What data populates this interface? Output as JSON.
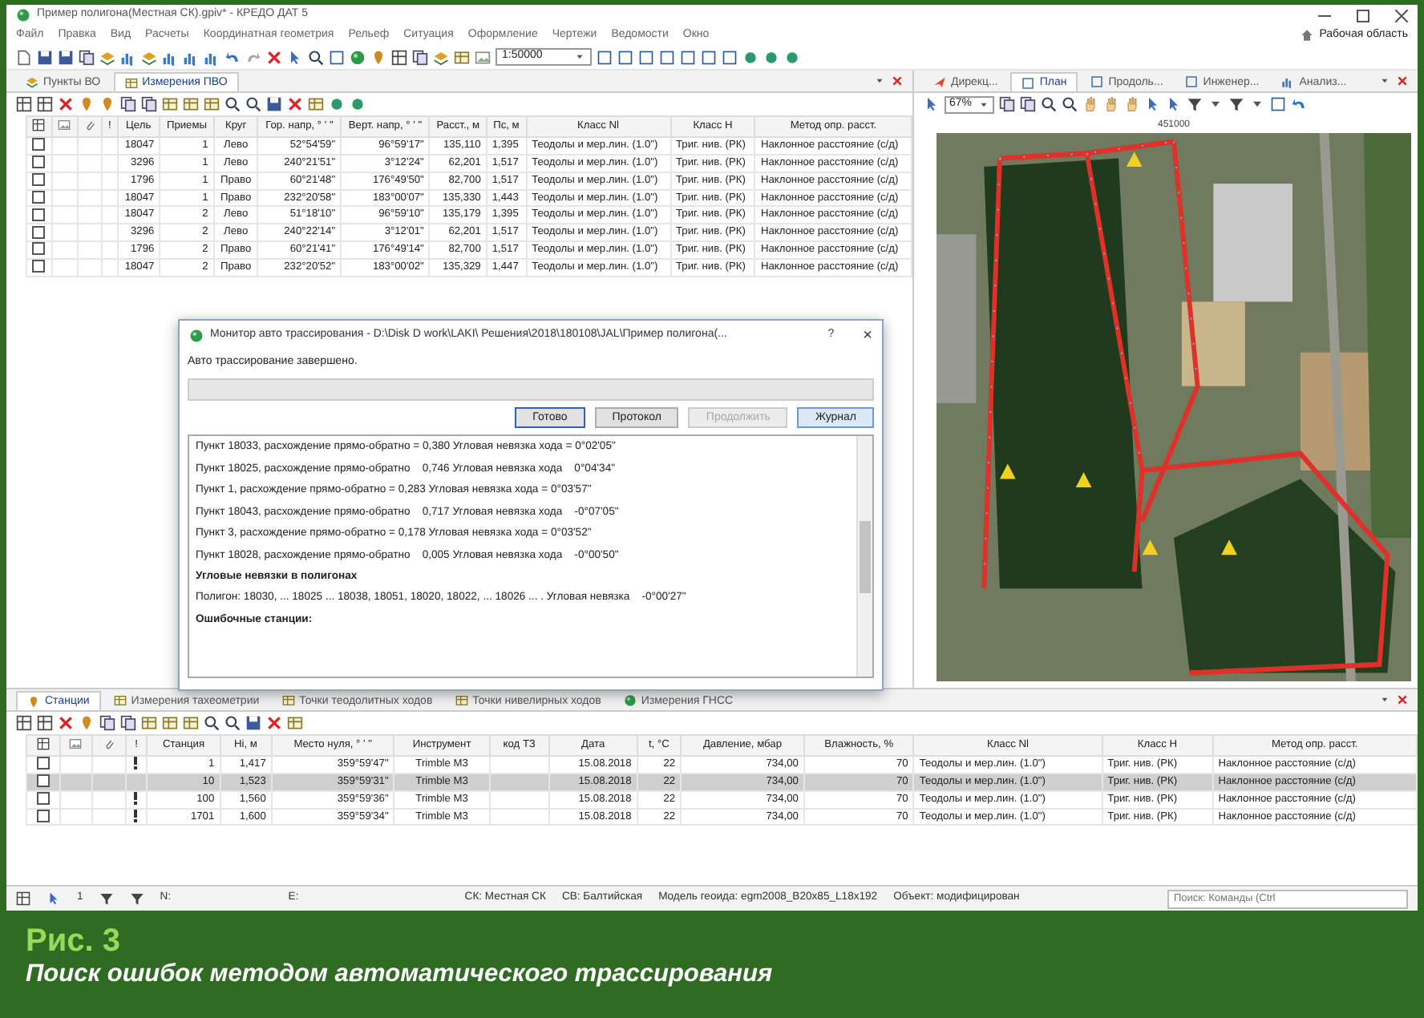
{
  "window": {
    "title": "Пример полигона(Местная СК).gpiv* - КРЕДО ДАТ 5",
    "workspace": "Рабочая область"
  },
  "menu": [
    "Файл",
    "Правка",
    "Вид",
    "Расчеты",
    "Координатная геометрия",
    "Рельеф",
    "Ситуация",
    "Оформление",
    "Чертежи",
    "Ведомости",
    "Окно"
  ],
  "toolbar": {
    "scale": "1:50000"
  },
  "measurements": {
    "tabs": [
      {
        "label": "Пункты ВО",
        "selected": false
      },
      {
        "label": "Измерения ПВО",
        "selected": true
      }
    ],
    "columns": [
      "!",
      "Цель",
      "Приемы",
      "Круг",
      "Гор. напр, ° ' \"",
      "Верт. напр, ° ' \"",
      "Расст., м",
      "Пс, м",
      "Класс Nl",
      "Класс H",
      "Метод опр. расст."
    ],
    "rows": [
      {
        "checked": false,
        "cells": [
          "",
          "18047",
          "1",
          "Лево",
          "52°54'59\"",
          "96°59'17\"",
          "135,110",
          "1,395",
          "Теодолы и мер.лин. (1.0\")",
          "Триг. нив. (РК)",
          "Наклонное расстояние (с/д)"
        ]
      },
      {
        "checked": false,
        "cells": [
          "",
          "3296",
          "1",
          "Лево",
          "240°21'51\"",
          "3°12'24\"",
          "62,201",
          "1,517",
          "Теодолы и мер.лин. (1.0\")",
          "Триг. нив. (РК)",
          "Наклонное расстояние (с/д)"
        ]
      },
      {
        "checked": false,
        "cells": [
          "",
          "1796",
          "1",
          "Право",
          "60°21'48\"",
          "176°49'50\"",
          "82,700",
          "1,517",
          "Теодолы и мер.лин. (1.0\")",
          "Триг. нив. (РК)",
          "Наклонное расстояние (с/д)"
        ]
      },
      {
        "checked": false,
        "cells": [
          "",
          "18047",
          "1",
          "Право",
          "232°20'58\"",
          "183°00'07\"",
          "135,330",
          "1,443",
          "Теодолы и мер.лин. (1.0\")",
          "Триг. нив. (РК)",
          "Наклонное расстояние (с/д)"
        ]
      },
      {
        "checked": false,
        "cells": [
          "",
          "18047",
          "2",
          "Лево",
          "51°18'10\"",
          "96°59'10\"",
          "135,179",
          "1,395",
          "Теодолы и мер.лин. (1.0\")",
          "Триг. нив. (РК)",
          "Наклонное расстояние (с/д)"
        ]
      },
      {
        "checked": false,
        "cells": [
          "",
          "3296",
          "2",
          "Лево",
          "240°22'14\"",
          "3°12'01\"",
          "62,201",
          "1,517",
          "Теодолы и мер.лин. (1.0\")",
          "Триг. нив. (РК)",
          "Наклонное расстояние (с/д)"
        ]
      },
      {
        "checked": false,
        "cells": [
          "",
          "1796",
          "2",
          "Право",
          "60°21'41\"",
          "176°49'14\"",
          "82,700",
          "1,517",
          "Теодолы и мер.лин. (1.0\")",
          "Триг. нив. (РК)",
          "Наклонное расстояние (с/д)"
        ]
      },
      {
        "checked": false,
        "cells": [
          "",
          "18047",
          "2",
          "Право",
          "232°20'52\"",
          "183°00'02\"",
          "135,329",
          "1,447",
          "Теодолы и мер.лин. (1.0\")",
          "Триг. нив. (РК)",
          "Наклонное расстояние (с/д)"
        ]
      }
    ]
  },
  "dialog": {
    "title": "Монитор авто трассирования - D:\\Disk D work\\LAKI\\ Решения\\2018\\180108\\JAL\\Пример полигона(...",
    "help": "?",
    "close": "×",
    "status": "Авто трассирование завершено.",
    "progress": {
      "level": 0
    },
    "buttons": [
      {
        "label": "Готово",
        "focused": true,
        "disabled": false,
        "pressed": false
      },
      {
        "label": "Протокол",
        "focused": false,
        "disabled": false,
        "pressed": false
      },
      {
        "label": "Продолжить",
        "focused": false,
        "disabled": true,
        "pressed": false
      },
      {
        "label": "Журнал",
        "focused": false,
        "disabled": false,
        "pressed": true
      }
    ],
    "log": [
      {
        "kind": "line",
        "text": "Пункт 18033, расхождение прямо-обратно = 0,380 Угловая невязка хода = 0°02'05\""
      },
      {
        "kind": "line",
        "text": "Пункт 18025, расхождение прямо-обратно    0,746 Угловая невязка хода    0°04'34\""
      },
      {
        "kind": "line",
        "text": "Пункт 1, расхождение прямо-обратно = 0,283 Угловая невязка хода = 0°03'57\""
      },
      {
        "kind": "line",
        "text": "Пункт 18043, расхождение прямо-обратно    0,717 Угловая невязка хода    -0°07'05\""
      },
      {
        "kind": "line",
        "text": "Пункт 3, расхождение прямо-обратно = 0,178 Угловая невязка хода = 0°03'52\""
      },
      {
        "kind": "line",
        "text": "Пункт 18028, расхождение прямо-обратно    0,005 Угловая невязка хода    -0°00'50\""
      },
      {
        "kind": "heading",
        "text": "Угловые невязки в полигонах"
      },
      {
        "kind": "line",
        "text": "Полигон: 18030, ... 18025 ... 18038, 18051, 18020, 18022, ... 18026 ... . Угловая невязка    -0°00'27\""
      },
      {
        "kind": "heading",
        "text": "Ошибочные станции:"
      }
    ]
  },
  "plan": {
    "tabs": [
      {
        "label": "Дирекц...",
        "selected": false
      },
      {
        "label": "План",
        "selected": true
      },
      {
        "label": "Продоль...",
        "selected": false
      },
      {
        "label": "Инженер...",
        "selected": false
      },
      {
        "label": "Анализ...",
        "selected": false
      }
    ],
    "zoom": "67%",
    "ruler_label": "451000"
  },
  "stations": {
    "tabs": [
      {
        "label": "Станции",
        "selected": true
      },
      {
        "label": "Измерения тахеометрии",
        "selected": false
      },
      {
        "label": "Точки теодолитных ходов",
        "selected": false
      },
      {
        "label": "Точки нивелирных ходов",
        "selected": false
      },
      {
        "label": "Измерения ГНСС",
        "selected": false
      }
    ],
    "columns": [
      "!",
      "Станция",
      "Hi, м",
      "Место нуля, ° ' \"",
      "Инструмент",
      "код ТЗ",
      "Дата",
      "t, °C",
      "Давление, мбар",
      "Влажность, %",
      "Класс Nl",
      "Класс H",
      "Метод опр. расст."
    ],
    "rows": [
      {
        "checked": false,
        "selected": false,
        "warning": true,
        "cells": [
          "",
          "1",
          "1,417",
          "359°59'47\"",
          "Trimble M3",
          "",
          "15.08.2018",
          "22",
          "734,00",
          "70",
          "Теодолы и мер.лин. (1.0\")",
          "Триг. нив. (РК)",
          "Наклонное расстояние (с/д)"
        ]
      },
      {
        "checked": false,
        "selected": true,
        "warning": false,
        "cells": [
          "",
          "10",
          "1,523",
          "359°59'31\"",
          "Trimble M3",
          "",
          "15.08.2018",
          "22",
          "734,00",
          "70",
          "Теодолы и мер.лин. (1.0\")",
          "Триг. нив. (РК)",
          "Наклонное расстояние (с/д)"
        ]
      },
      {
        "checked": false,
        "selected": false,
        "warning": true,
        "cells": [
          "",
          "100",
          "1,560",
          "359°59'36\"",
          "Trimble M3",
          "",
          "15.08.2018",
          "22",
          "734,00",
          "70",
          "Теодолы и мер.лин. (1.0\")",
          "Триг. нив. (РК)",
          "Наклонное расстояние (с/д)"
        ]
      },
      {
        "checked": false,
        "selected": false,
        "warning": true,
        "cells": [
          "",
          "1701",
          "1,600",
          "359°59'34\"",
          "Trimble M3",
          "",
          "15.08.2018",
          "22",
          "734,00",
          "70",
          "Теодолы и мер.лин. (1.0\")",
          "Триг. нив. (РК)",
          "Наклонное расстояние (с/д)"
        ]
      }
    ]
  },
  "status_bar": {
    "count": "1",
    "n": "N:",
    "e": "E:",
    "cs": "СК: Местная СК",
    "height_system": "СВ: Балтийская",
    "geoid": "Модель геоида: egm2008_B20x85_L18x192",
    "object": "Объект: модифицирован",
    "search_placeholder": "Поиск: Команды (Ctrl"
  },
  "caption": {
    "label": "Рис. 3",
    "text": "Поиск ошибок методом автоматического трассирования"
  }
}
